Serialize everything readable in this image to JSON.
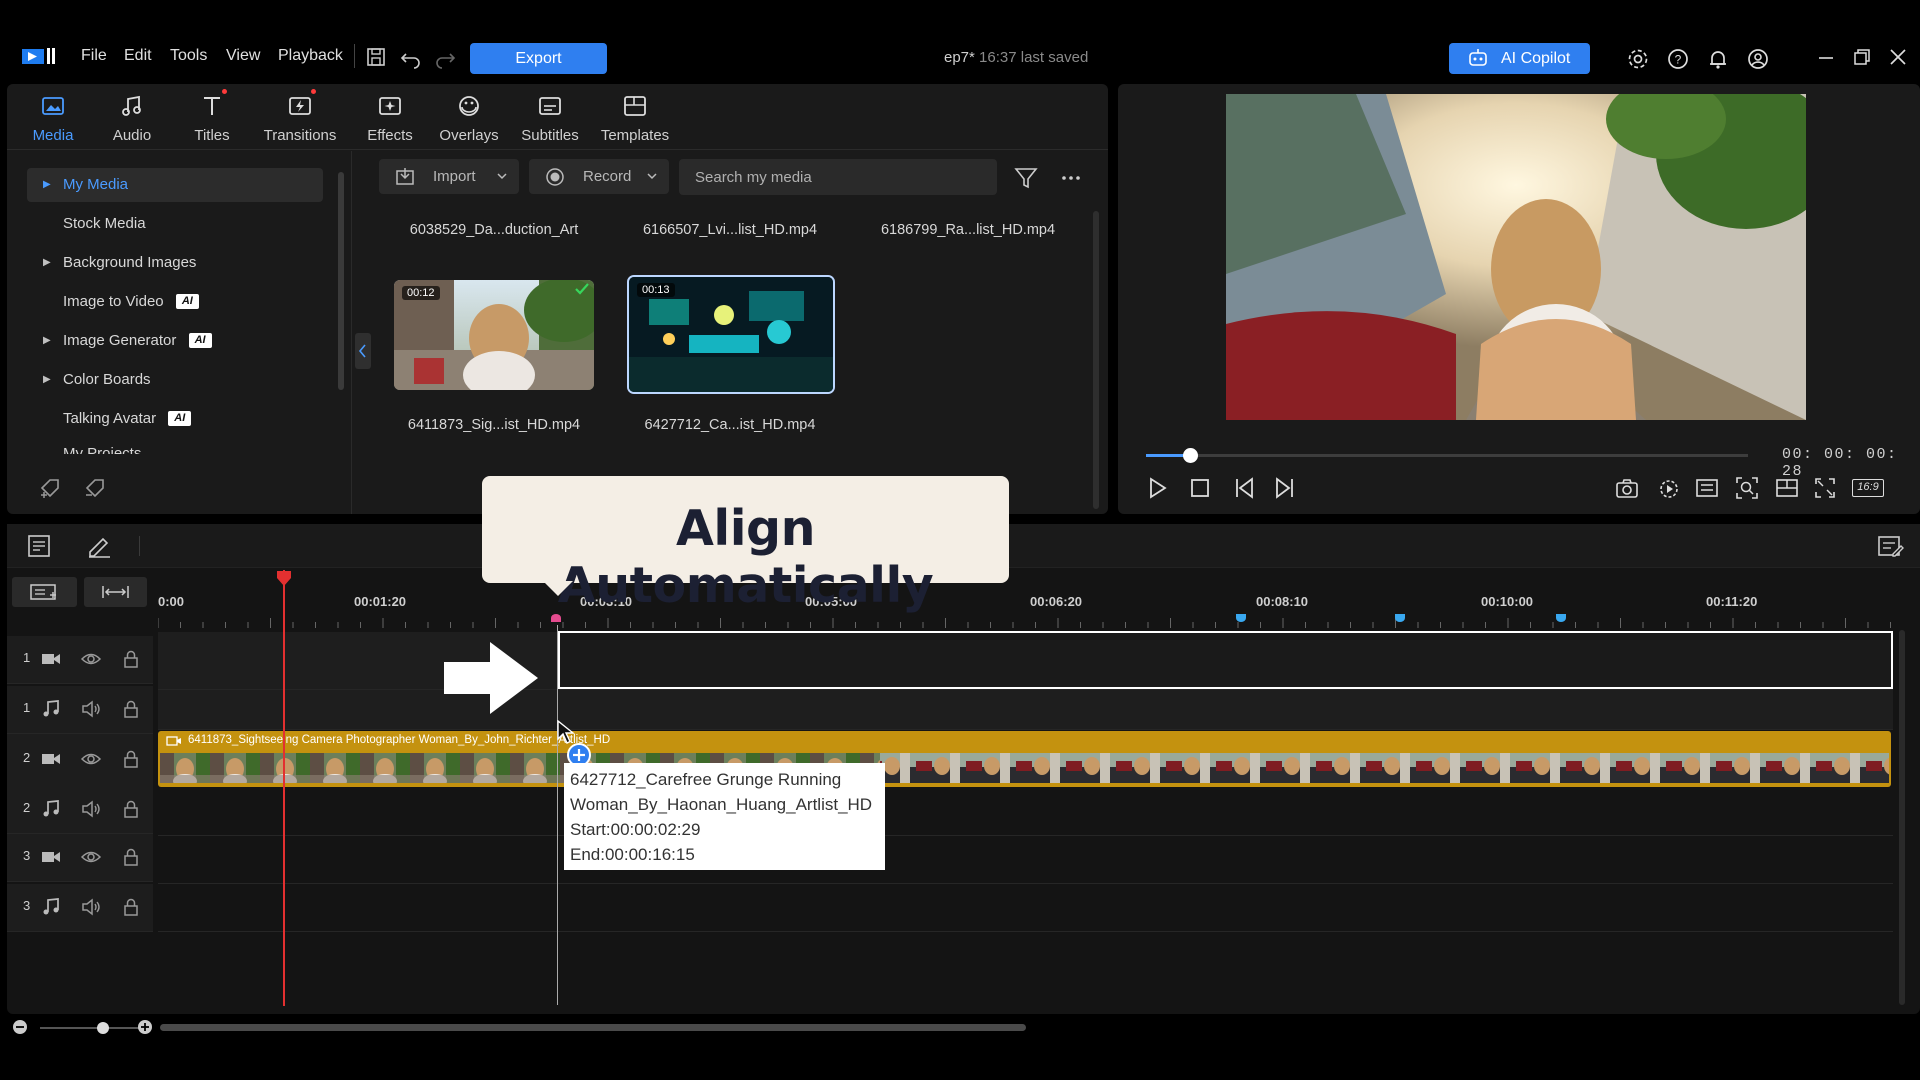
{
  "menu": {
    "file": "File",
    "edit": "Edit",
    "tools": "Tools",
    "view": "View",
    "playback": "Playback"
  },
  "export_label": "Export",
  "project": {
    "name": "ep7*",
    "saved": "16:37 last saved"
  },
  "copilot_label": "AI Copilot",
  "tabs": [
    {
      "label": "Media"
    },
    {
      "label": "Audio"
    },
    {
      "label": "Titles"
    },
    {
      "label": "Transitions"
    },
    {
      "label": "Effects"
    },
    {
      "label": "Overlays"
    },
    {
      "label": "Subtitles"
    },
    {
      "label": "Templates"
    }
  ],
  "sidebar": {
    "items": [
      {
        "label": "My Media"
      },
      {
        "label": "Stock Media"
      },
      {
        "label": "Background Images"
      },
      {
        "label": "Image to Video"
      },
      {
        "label": "Image Generator"
      },
      {
        "label": "Color Boards"
      },
      {
        "label": "Talking Avatar"
      },
      {
        "label": "My Projects"
      }
    ],
    "ai_badge": "AI"
  },
  "toolbar": {
    "import_label": "Import",
    "record_label": "Record",
    "search_placeholder": "Search my media"
  },
  "media": {
    "files": [
      {
        "name": "6038529_Da...duction_Art"
      },
      {
        "name": "6166507_Lvi...list_HD.mp4"
      },
      {
        "name": "6186799_Ra...list_HD.mp4"
      },
      {
        "name": "6411873_Sig...ist_HD.mp4",
        "duration": "00:12"
      },
      {
        "name": "6427712_Ca...ist_HD.mp4",
        "duration": "00:13"
      }
    ]
  },
  "preview": {
    "timecode": "00: 00: 00: 28",
    "aspect": "16:9",
    "progress": 0.08
  },
  "timeline": {
    "ruler_labels": [
      "0:00",
      "00:01:20",
      "00:03:10",
      "00:05:00",
      "00:06:20",
      "00:08:10",
      "00:10:00",
      "00:11:20"
    ],
    "tracks": [
      {
        "num": "1",
        "kind": "video"
      },
      {
        "num": "1",
        "kind": "audio"
      },
      {
        "num": "2",
        "kind": "video"
      },
      {
        "num": "2",
        "kind": "audio"
      },
      {
        "num": "3",
        "kind": "video"
      },
      {
        "num": "3",
        "kind": "audio"
      }
    ],
    "clip_title": "6411873_Sightseeing Camera Photographer Woman_By_John_Richter_Artlist_HD",
    "tooltip": {
      "line1": "6427712_Carefree Grunge Running",
      "line2": "Woman_By_Haonan_Huang_Artlist_HD",
      "start": "Start:00:00:02:29",
      "end": "End:00:00:16:15"
    }
  },
  "overlay": {
    "caption": "Align Automatically"
  },
  "colors": {
    "accent": "#2f7ff0",
    "clip": "#c4920f",
    "playhead": "#e33030",
    "caption_bg": "#f4eee5"
  }
}
